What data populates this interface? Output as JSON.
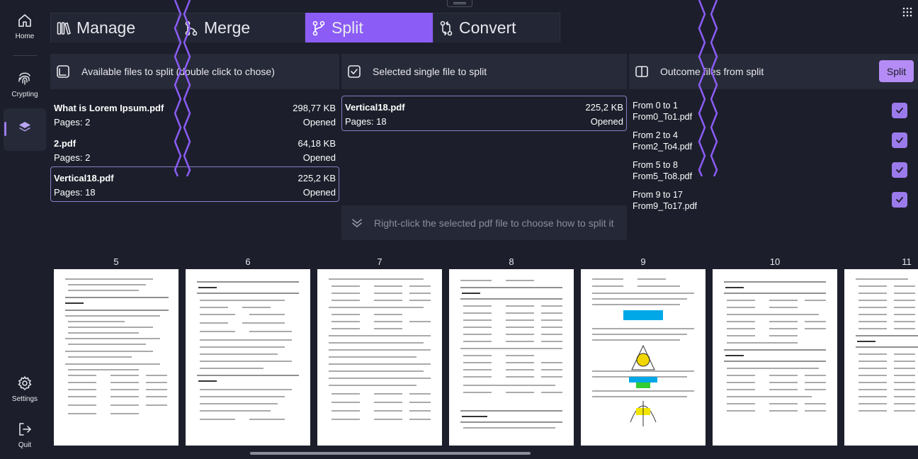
{
  "sidebar": {
    "home_label": "Home",
    "crypting_label": "Crypting",
    "settings_label": "Settings",
    "quit_label": "Quit"
  },
  "tabs": [
    {
      "label": "Manage"
    },
    {
      "label": "Merge"
    },
    {
      "label": "Split"
    },
    {
      "label": "Convert"
    }
  ],
  "panels": {
    "available_title": "Available files to split (double click to chose)",
    "selected_title": "Selected single file to split",
    "outcome_title": "Outcome files from split",
    "split_button": "Split"
  },
  "available_files": [
    {
      "name": "What is Lorem Ipsum.pdf",
      "size": "298,77 KB",
      "pages": "Pages: 2",
      "status": "Opened"
    },
    {
      "name": "2.pdf",
      "size": "64,18 KB",
      "pages": "Pages: 2",
      "status": "Opened"
    },
    {
      "name": "Vertical18.pdf",
      "size": "225,2 KB",
      "pages": "Pages: 18",
      "status": "Opened"
    }
  ],
  "selected_file": {
    "name": "Vertical18.pdf",
    "size": "225,2 KB",
    "pages": "Pages: 18",
    "status": "Opened"
  },
  "hint": "Right-click the selected pdf file to choose how to split it",
  "outcomes": [
    {
      "range": "From 0 to 1",
      "file": "From0_To1.pdf"
    },
    {
      "range": "From 2 to 4",
      "file": "From2_To4.pdf"
    },
    {
      "range": "From 5 to 8",
      "file": "From5_To8.pdf"
    },
    {
      "range": "From 9 to 17",
      "file": "From9_To17.pdf"
    }
  ],
  "pages": [
    "5",
    "6",
    "7",
    "8",
    "9",
    "10",
    "11"
  ],
  "colors": {
    "accent": "#8b5cf6",
    "accent_light": "#b58cf5",
    "background": "#1c1f2b",
    "panel": "#272a38"
  }
}
